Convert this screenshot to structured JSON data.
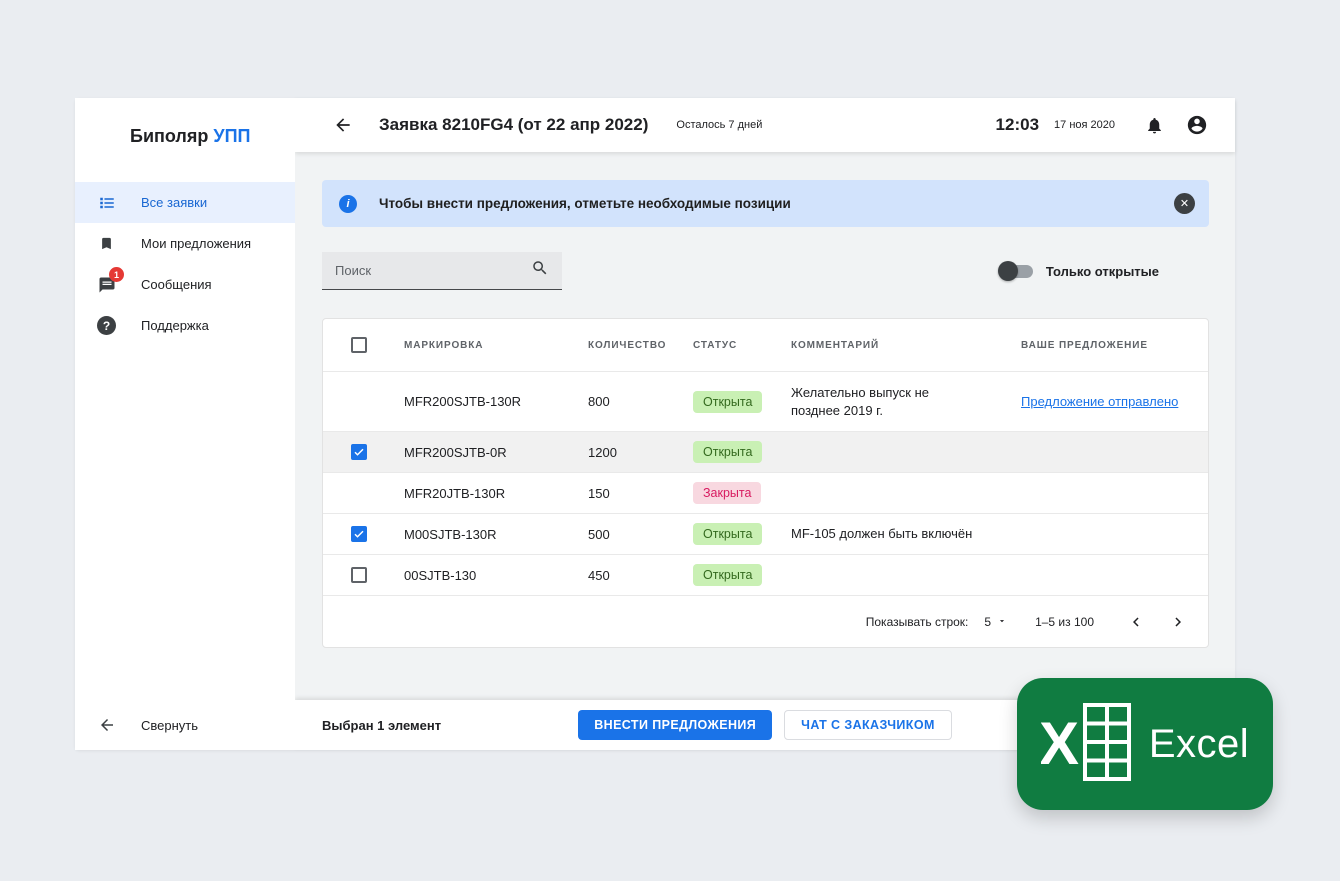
{
  "colors": {
    "accent_blue": "#1a73e8",
    "banner_bg": "#d2e3fc",
    "status_open_bg": "#c9f0b4",
    "status_open_text": "#33691e",
    "status_closed_bg": "#f8d8e0",
    "status_closed_text": "#d81b60",
    "badge_red": "#e53935",
    "excel_green": "#107c41"
  },
  "logo": {
    "part1": "Биполяр",
    "part2": "УПП"
  },
  "sidebar": {
    "items": [
      {
        "label": "Все заявки",
        "icon": "list-icon",
        "active": true
      },
      {
        "label": "Мои предложения",
        "icon": "bookmark-icon",
        "active": false
      },
      {
        "label": "Сообщения",
        "icon": "chat-icon",
        "badge": "1",
        "active": false
      },
      {
        "label": "Поддержка",
        "icon": "help-icon",
        "active": false
      }
    ],
    "collapse_label": "Свернуть"
  },
  "header": {
    "title": "Заявка 8210FG4 (от 22 апр 2022)",
    "deadline": "Осталось 7 дней",
    "time": "12:03",
    "date": "17 ноя 2020"
  },
  "banner": {
    "text": "Чтобы внести предложения, отметьте необходимые позиции"
  },
  "search": {
    "placeholder": "Поиск"
  },
  "filter": {
    "label": "Только открытые",
    "enabled": false
  },
  "table": {
    "columns": [
      "МАРКИРОВКА",
      "КОЛИЧЕСТВО",
      "СТАТУС",
      "КОММЕНТАРИЙ",
      "ВАШЕ ПРЕДЛОЖЕНИЕ"
    ],
    "rows": [
      {
        "marking": "MFR200SJTB-130R",
        "quantity": "800",
        "status": "Открыта",
        "status_type": "open",
        "comment": "Желательно выпуск не позднее 2019 г.",
        "offer": "Предложение отправлено",
        "checkbox": "none",
        "selected": false
      },
      {
        "marking": "MFR200SJTB-0R",
        "quantity": "1200",
        "status": "Открыта",
        "status_type": "open",
        "comment": "",
        "offer": "",
        "checkbox": "checked",
        "selected": true
      },
      {
        "marking": "MFR20JTB-130R",
        "quantity": "150",
        "status": "Закрыта",
        "status_type": "closed",
        "comment": "",
        "offer": "",
        "checkbox": "none",
        "selected": false
      },
      {
        "marking": "M00SJTB-130R",
        "quantity": "500",
        "status": "Открыта",
        "status_type": "open",
        "comment": "MF-105 должен быть включён",
        "offer": "",
        "checkbox": "checked",
        "selected": false
      },
      {
        "marking": "00SJTB-130",
        "quantity": "450",
        "status": "Открыта",
        "status_type": "open",
        "comment": "",
        "offer": "",
        "checkbox": "unchecked",
        "selected": false
      }
    ],
    "pagination": {
      "rows_label": "Показывать строк:",
      "rows_value": "5",
      "range": "1–5 из 100"
    }
  },
  "footer": {
    "selection": "Выбран 1 элемент",
    "primary_button": "ВНЕСТИ ПРЕДЛОЖЕНИЯ",
    "secondary_button": "ЧАТ С ЗАКАЗЧИКОМ"
  },
  "overlay": {
    "label": "Excel"
  }
}
